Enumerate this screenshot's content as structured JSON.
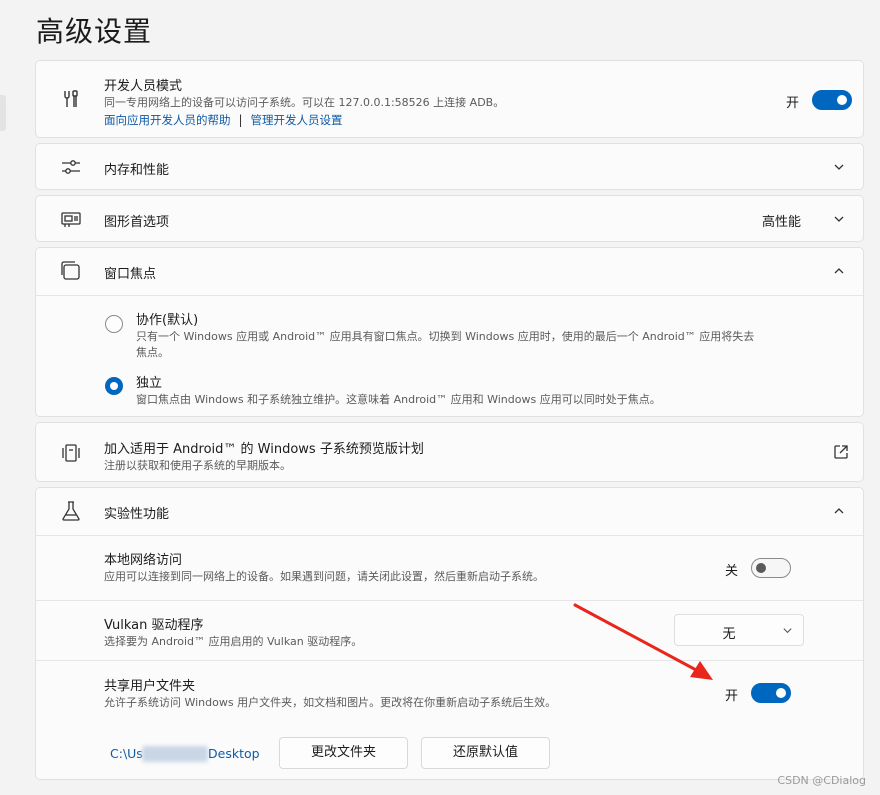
{
  "page": {
    "title": "高级设置"
  },
  "developer_mode": {
    "title": "开发人员模式",
    "description": "同一专用网络上的设备可以访问子系统。可以在 127.0.0.1:58526 上连接 ADB。",
    "link_help": "面向应用开发人员的帮助",
    "link_separator": "|",
    "link_manage": "管理开发人员设置",
    "state_label": "开",
    "enabled": true
  },
  "memory": {
    "title": "内存和性能"
  },
  "graphics": {
    "title": "图形首选项",
    "value": "高性能"
  },
  "window_focus": {
    "title": "窗口焦点",
    "options": [
      {
        "label": "协作(默认)",
        "description_line1": "只有一个 Windows 应用或 Android™ 应用具有窗口焦点。切换到 Windows 应用时，使用的最后一个 Android™ 应用将失去",
        "description_line2": "焦点。",
        "selected": false
      },
      {
        "label": "独立",
        "description_line1": "窗口焦点由 Windows 和子系统独立维护。这意味着 Android™ 应用和 Windows 应用可以同时处于焦点。",
        "selected": true
      }
    ]
  },
  "preview_program": {
    "title": "加入适用于 Android™ 的 Windows 子系统预览版计划",
    "description": "注册以获取和使用子系统的早期版本。"
  },
  "experimental": {
    "title": "实验性功能",
    "local_network": {
      "title": "本地网络访问",
      "description": "应用可以连接到同一网络上的设备。如果遇到问题，请关闭此设置，然后重新启动子系统。",
      "state_label": "关",
      "enabled": false
    },
    "vulkan": {
      "title": "Vulkan 驱动程序",
      "description": "选择要为 Android™ 应用启用的 Vulkan 驱动程序。",
      "selected_value": "无"
    },
    "shared_folders": {
      "title": "共享用户文件夹",
      "description": "允许子系统访问 Windows 用户文件夹，如文档和图片。更改将在你重新启动子系统后生效。",
      "state_label": "开",
      "enabled": true,
      "path_prefix": "C:\\Us",
      "path_suffix": "Desktop",
      "change_button": "更改文件夹",
      "reset_button": "还原默认值"
    }
  },
  "watermark": "CSDN @CDialog",
  "colors": {
    "accent": "#0067c0",
    "annotation_arrow": "#e8261c",
    "link": "#0f5ba8"
  }
}
